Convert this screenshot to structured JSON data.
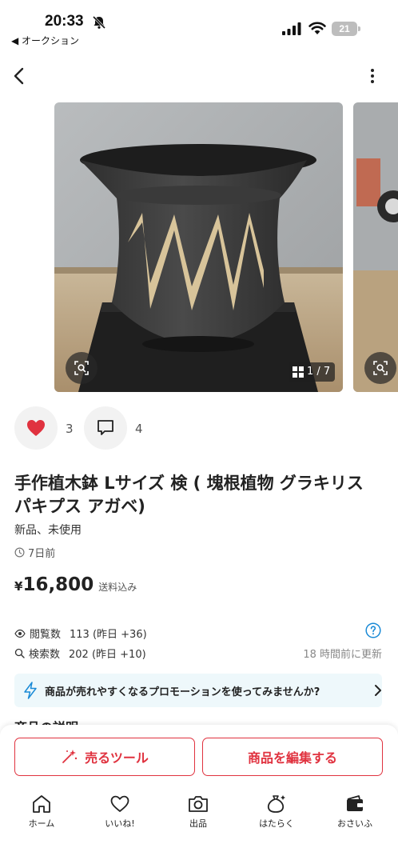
{
  "status_bar": {
    "time": "20:33",
    "back_app_label": "◀ オークション",
    "battery": "21"
  },
  "nav": {
    "back_icon": "chevron-left-icon",
    "more_icon": "more-vertical-icon"
  },
  "gallery": {
    "counter": "1 / 7",
    "zoom_icon": "image-search-icon"
  },
  "engagement": {
    "like_count": "3",
    "comment_count": "4"
  },
  "item": {
    "title": "手作植木鉢 Lサイズ 検 ( 塊根植物 グラキリス パキプス アガベ)",
    "condition": "新品、未使用",
    "listed_ago": "7日前",
    "price_symbol": "¥",
    "price": "16,800",
    "shipping": "送料込み"
  },
  "stats": {
    "views_label": "閲覧数",
    "views_value": "113 (昨日 +36)",
    "search_label": "検索数",
    "search_value": "202 (昨日 +10)",
    "updated": "18 時間前に更新"
  },
  "promo": {
    "text": "商品が売れやすくなるプロモーションを使ってみませんか?"
  },
  "section": {
    "description_heading": "商品の説明"
  },
  "actions": {
    "sell_tool": "売るツール",
    "edit_item": "商品を編集する"
  },
  "tabbar": {
    "items": [
      {
        "label": "ホーム",
        "icon": "home-icon"
      },
      {
        "label": "いいね!",
        "icon": "heart-outline-icon"
      },
      {
        "label": "出品",
        "icon": "camera-icon"
      },
      {
        "label": "はたらく",
        "icon": "money-bag-icon"
      },
      {
        "label": "おさいふ",
        "icon": "wallet-icon"
      }
    ]
  },
  "colors": {
    "accent_red": "#e0323f",
    "promo_bg": "#eef8fb",
    "link_blue": "#1a8ad6"
  }
}
